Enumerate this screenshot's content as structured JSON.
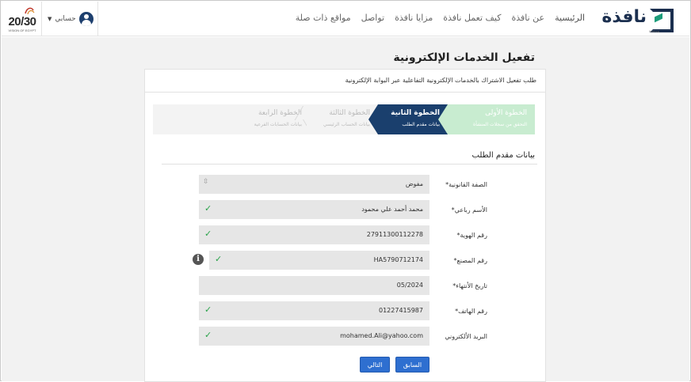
{
  "header": {
    "vision_number": "20/30",
    "vision_sub": "VISION OF EGYPT",
    "account_label": "حسابي",
    "nav": [
      "الرئيسية",
      "عن نافذة",
      "كيف تعمل نافذة",
      "مزايا نافذة",
      "تواصل",
      "مواقع ذات صلة"
    ],
    "logo_word": "نافذة",
    "logo_sub": "Nafeza"
  },
  "page_title": "تفعيل الخدمات الإلكترونية",
  "card_header": "طلب تفعيل الاشتراك بالخدمات الإلكترونية التفاعلية عبر البوابة الإلكترونية",
  "steps": [
    {
      "title": "الخطوة الأولى",
      "sub": "التحقق من سجلات المنشأة"
    },
    {
      "title": "الخطوة الثانية",
      "sub": "بيانات مقدم الطلب"
    },
    {
      "title": "الخطوة الثالثة",
      "sub": "بيانات الحساب الرئيسي"
    },
    {
      "title": "الخطوة الرابعة",
      "sub": "بيانات الحسابات الفرعية"
    }
  ],
  "section_title": "بيانات مقدم الطلب",
  "fields": [
    {
      "label": "الصفة القانونية*",
      "value": "مفوض"
    },
    {
      "label": "الأسم رباعي*",
      "value": "محمد أحمد علي محمود"
    },
    {
      "label": "رقم الهوية*",
      "value": "27911300112278"
    },
    {
      "label": "رقم المصنع*",
      "value": "HA5790712174"
    },
    {
      "label": "تاريخ الأنتهاء*",
      "value": "05/2024"
    },
    {
      "label": "رقم الهاتف*",
      "value": "01227415987"
    },
    {
      "label": "البريد الألكتروني",
      "value": "mohamed.Ali@yahoo.com"
    }
  ],
  "buttons": {
    "prev": "السابق",
    "next": "التالي"
  },
  "colors": {
    "primary": "#1a3f6d",
    "button": "#2e6fd0",
    "success": "#2aa34a",
    "completed_step": "#c8ecd0"
  }
}
